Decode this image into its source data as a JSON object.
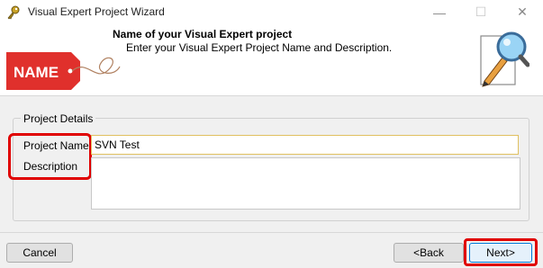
{
  "window": {
    "title": "Visual Expert Project Wizard",
    "icons": {
      "app": "key-icon",
      "minimize": "minimize-icon",
      "maximize": "maximize-icon",
      "close": "close-icon"
    }
  },
  "header": {
    "title": "Name of your Visual Expert project",
    "subtitle": "Enter your Visual Expert Project Name and Description.",
    "tag_text": "NAME",
    "tag_color": "#e0302c",
    "illustration": "magnifier-pencil-icon"
  },
  "form": {
    "group_label": "Project Details",
    "project_name_label": "Project Name",
    "project_name_value": "SVN Test",
    "description_label": "Description",
    "description_value": ""
  },
  "footer": {
    "cancel_label": "Cancel",
    "back_label": "<Back",
    "next_label": "Next>"
  },
  "colors": {
    "highlight": "#e00000",
    "accent": "#0078d7"
  }
}
